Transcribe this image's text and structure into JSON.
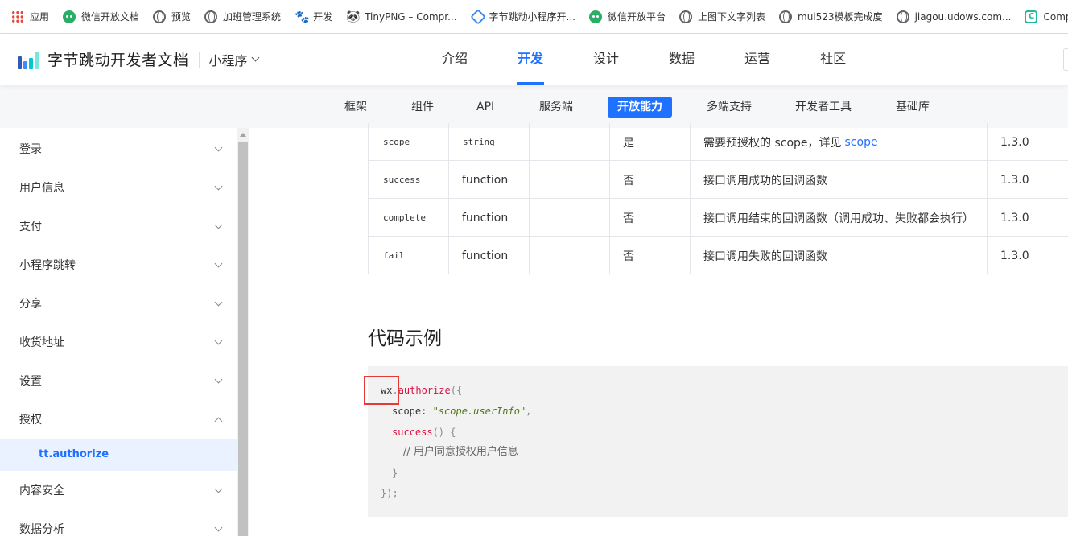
{
  "bookmarks": [
    {
      "label": "应用",
      "icon": "apps-grid-icon"
    },
    {
      "label": "微信开放文档",
      "icon": "wechat-icon"
    },
    {
      "label": "预览",
      "icon": "globe-icon"
    },
    {
      "label": "加班管理系统",
      "icon": "globe-icon"
    },
    {
      "label": "开发",
      "icon": "paw-icon"
    },
    {
      "label": "TinyPNG – Compr...",
      "icon": "panda-icon"
    },
    {
      "label": "字节跳动小程序开...",
      "icon": "diamond-icon"
    },
    {
      "label": "微信开放平台",
      "icon": "wechat-icon"
    },
    {
      "label": "上图下文字列表",
      "icon": "globe-icon"
    },
    {
      "label": "mui523模板完成度",
      "icon": "globe-icon"
    },
    {
      "label": "jiagou.udows.com...",
      "icon": "globe-icon"
    },
    {
      "label": "Compr",
      "icon": "compress-icon"
    }
  ],
  "header": {
    "site_title": "字节跳动开发者文档",
    "product": "小程序",
    "nav": [
      "介绍",
      "开发",
      "设计",
      "数据",
      "运营",
      "社区"
    ],
    "active_nav": "开发"
  },
  "subnav": {
    "items": [
      "框架",
      "组件",
      "API",
      "服务端",
      "开放能力",
      "多端支持",
      "开发者工具",
      "基础库"
    ],
    "active": "开放能力"
  },
  "sidebar": {
    "items": [
      "登录",
      "用户信息",
      "支付",
      "小程序跳转",
      "分享",
      "收货地址",
      "设置",
      "授权",
      "内容安全",
      "数据分析"
    ],
    "expanded": "授权",
    "child": "tt.authorize"
  },
  "table": {
    "rows": [
      {
        "name": "scope",
        "type": "string",
        "default": "",
        "required": "是",
        "desc": "需要预授权的 scope，详见",
        "desc_link": "scope",
        "version": "1.3.0"
      },
      {
        "name": "success",
        "type": "function",
        "default": "",
        "required": "否",
        "desc": "接口调用成功的回调函数",
        "desc_link": "",
        "version": "1.3.0"
      },
      {
        "name": "complete",
        "type": "function",
        "default": "",
        "required": "否",
        "desc": "接口调用结束的回调函数（调用成功、失败都会执行）",
        "desc_link": "",
        "version": "1.3.0"
      },
      {
        "name": "fail",
        "type": "function",
        "default": "",
        "required": "否",
        "desc": "接口调用失败的回调函数",
        "desc_link": "",
        "version": "1.3.0"
      }
    ]
  },
  "section_title": "代码示例",
  "code": {
    "l1_obj": "wx",
    "l1_dot": ".",
    "l1_fn": "authorize",
    "l1_open": "({",
    "l2_key": "scope: ",
    "l2_val": "\"scope.userInfo\"",
    "l2_comma": ",",
    "l3_fn": "success",
    "l3_rest": "() {",
    "l4_comment": "// 用户同意授权用户信息",
    "l5": "}",
    "l6": "});"
  },
  "colors": {
    "accent": "#1f71ff",
    "highlight_box": "#e53935"
  }
}
